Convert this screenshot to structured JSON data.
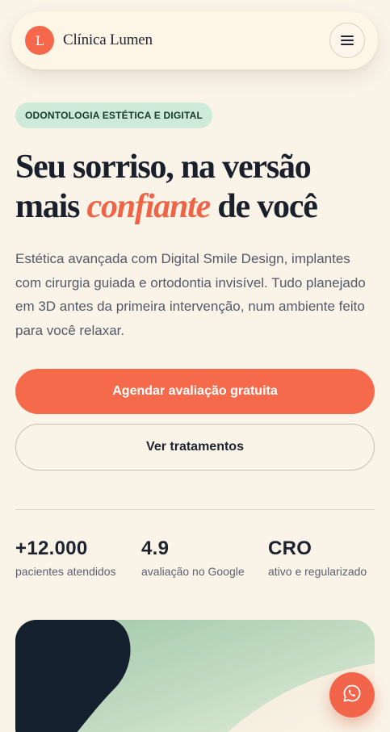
{
  "header": {
    "logo_letter": "L",
    "brand_name": "Clínica Lumen",
    "menu_icon": "hamburger-menu-icon"
  },
  "hero": {
    "badge": "ODONTOLOGIA ESTÉTICA E DIGITAL",
    "headline_part1": "Seu sorriso, na versão mais ",
    "headline_accent": "confiante",
    "headline_part2": " de você",
    "lead": "Estética avançada com Digital Smile Design, implantes com cirurgia guiada e ortodontia invisível. Tudo planejado em 3D antes da primeira intervenção, num ambiente feito para você relaxar.",
    "cta_primary": "Agendar avaliação gratuita",
    "cta_secondary": "Ver tratamentos"
  },
  "stats": [
    {
      "value": "+12.000",
      "label": "pacientes atendidos"
    },
    {
      "value": "4.9",
      "label": "avaliação no Google"
    },
    {
      "value": "CRO",
      "label": "ativo e regularizado"
    }
  ],
  "floating": {
    "whatsapp_icon": "whatsapp-icon"
  },
  "colors": {
    "background": "#faf3e8",
    "accent": "#f66a4c",
    "badge_bg": "#cdebd8",
    "text": "#1c2230",
    "muted": "#5c6070"
  }
}
